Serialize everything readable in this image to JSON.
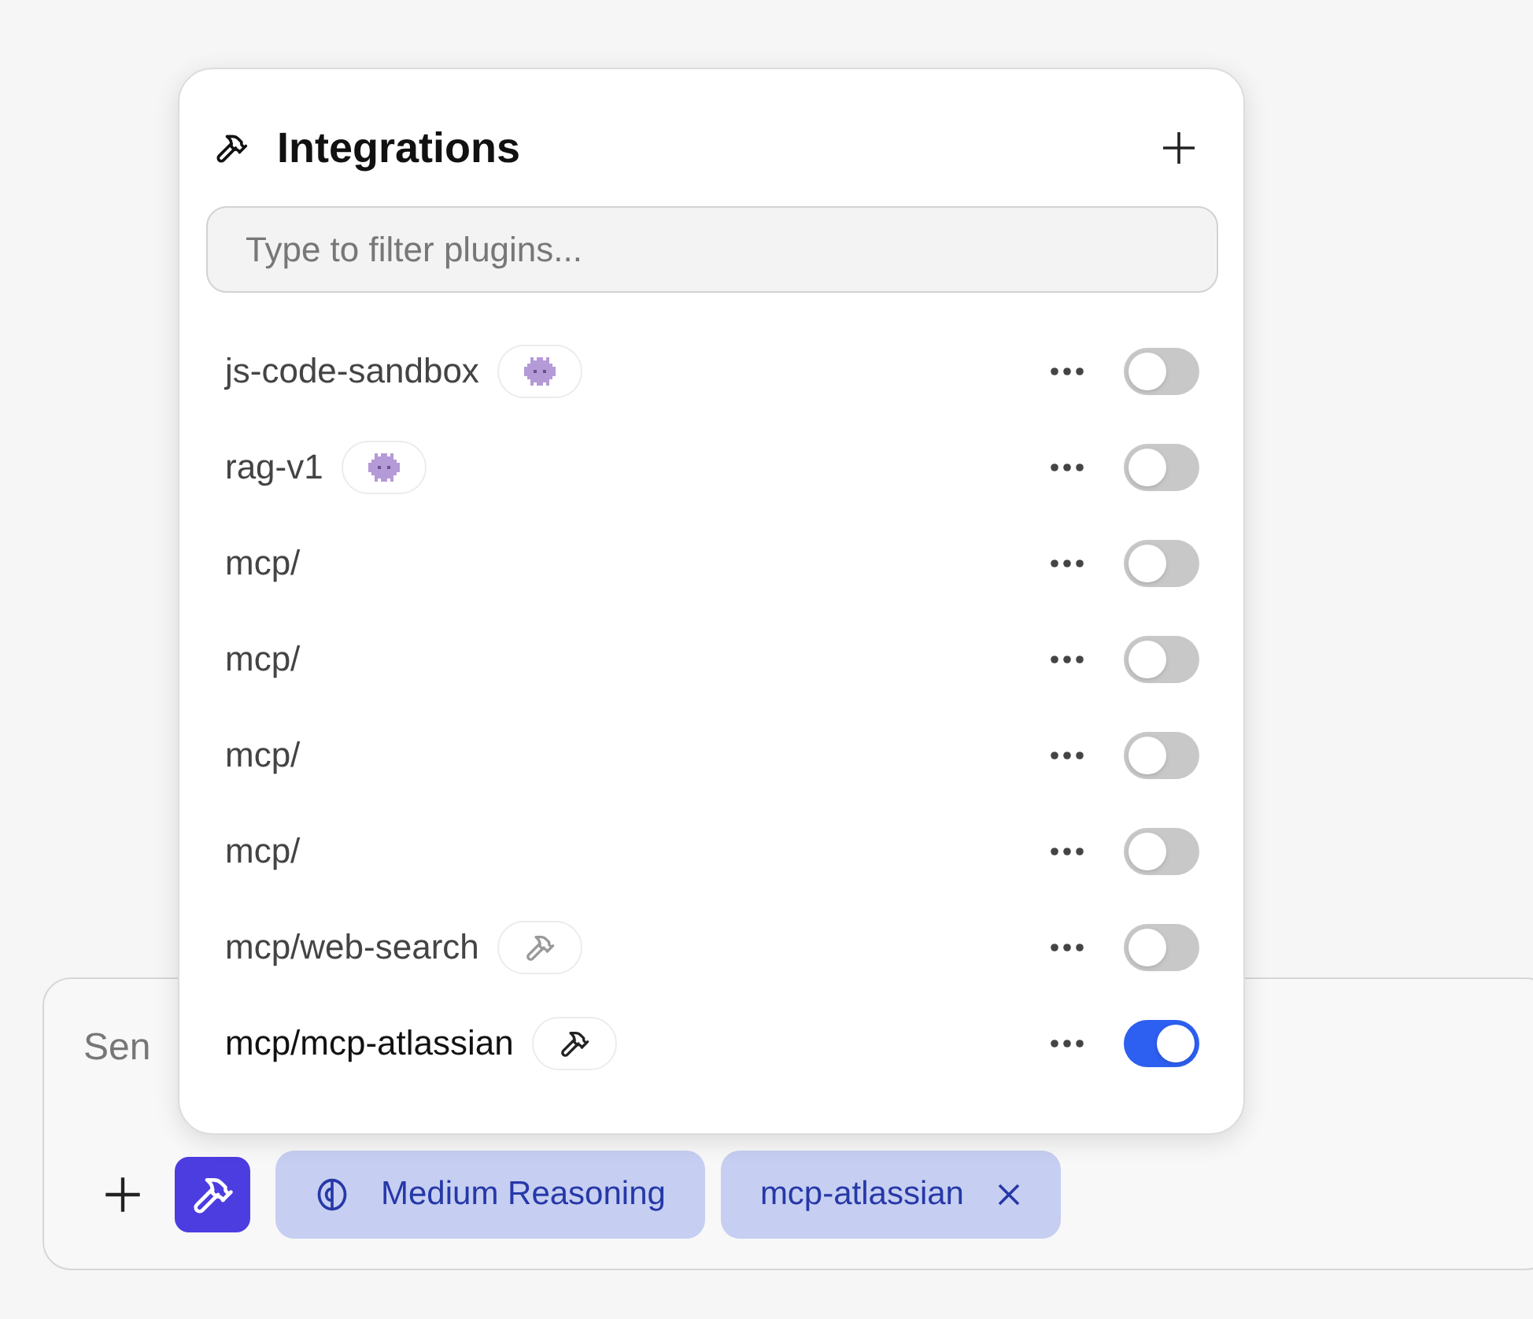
{
  "popup": {
    "title": "Integrations",
    "search": {
      "placeholder": "Type to filter plugins..."
    },
    "plugins": [
      {
        "name": "js-code-sandbox",
        "kind": "plugin",
        "on": false
      },
      {
        "name": "rag-v1",
        "kind": "plugin",
        "on": false
      },
      {
        "name": "mcp/",
        "kind": "plain",
        "on": false
      },
      {
        "name": "mcp/",
        "kind": "plain",
        "on": false
      },
      {
        "name": "mcp/",
        "kind": "plain",
        "on": false
      },
      {
        "name": "mcp/",
        "kind": "plain",
        "on": false
      },
      {
        "name": "mcp/web-search",
        "kind": "tool",
        "on": false
      },
      {
        "name": "mcp/mcp-atlassian",
        "kind": "tool",
        "on": true
      }
    ]
  },
  "composer": {
    "placeholder": "Sen",
    "chips": [
      {
        "label": "Medium Reasoning",
        "kind": "reasoning"
      },
      {
        "label": "mcp-atlassian",
        "kind": "removable"
      }
    ]
  }
}
